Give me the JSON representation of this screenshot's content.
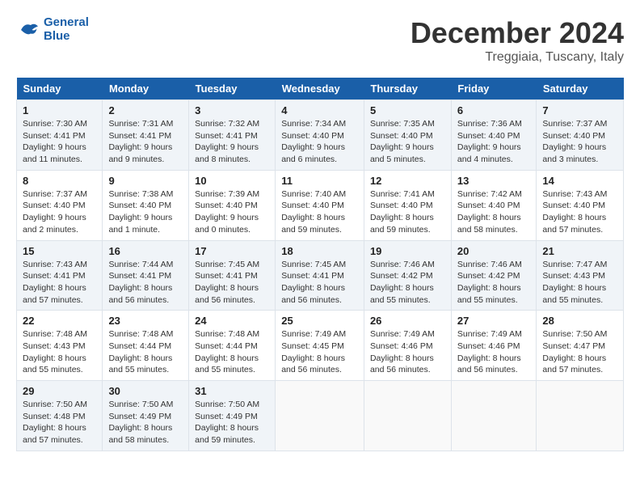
{
  "header": {
    "logo_line1": "General",
    "logo_line2": "Blue",
    "month": "December 2024",
    "location": "Treggiaia, Tuscany, Italy"
  },
  "days_of_week": [
    "Sunday",
    "Monday",
    "Tuesday",
    "Wednesday",
    "Thursday",
    "Friday",
    "Saturday"
  ],
  "weeks": [
    [
      {
        "day": 1,
        "rise": "7:30 AM",
        "set": "4:41 PM",
        "daylight": "9 hours and 11 minutes."
      },
      {
        "day": 2,
        "rise": "7:31 AM",
        "set": "4:41 PM",
        "daylight": "9 hours and 9 minutes."
      },
      {
        "day": 3,
        "rise": "7:32 AM",
        "set": "4:41 PM",
        "daylight": "9 hours and 8 minutes."
      },
      {
        "day": 4,
        "rise": "7:34 AM",
        "set": "4:40 PM",
        "daylight": "9 hours and 6 minutes."
      },
      {
        "day": 5,
        "rise": "7:35 AM",
        "set": "4:40 PM",
        "daylight": "9 hours and 5 minutes."
      },
      {
        "day": 6,
        "rise": "7:36 AM",
        "set": "4:40 PM",
        "daylight": "9 hours and 4 minutes."
      },
      {
        "day": 7,
        "rise": "7:37 AM",
        "set": "4:40 PM",
        "daylight": "9 hours and 3 minutes."
      }
    ],
    [
      {
        "day": 8,
        "rise": "7:37 AM",
        "set": "4:40 PM",
        "daylight": "9 hours and 2 minutes."
      },
      {
        "day": 9,
        "rise": "7:38 AM",
        "set": "4:40 PM",
        "daylight": "9 hours and 1 minute."
      },
      {
        "day": 10,
        "rise": "7:39 AM",
        "set": "4:40 PM",
        "daylight": "9 hours and 0 minutes."
      },
      {
        "day": 11,
        "rise": "7:40 AM",
        "set": "4:40 PM",
        "daylight": "8 hours and 59 minutes."
      },
      {
        "day": 12,
        "rise": "7:41 AM",
        "set": "4:40 PM",
        "daylight": "8 hours and 59 minutes."
      },
      {
        "day": 13,
        "rise": "7:42 AM",
        "set": "4:40 PM",
        "daylight": "8 hours and 58 minutes."
      },
      {
        "day": 14,
        "rise": "7:43 AM",
        "set": "4:40 PM",
        "daylight": "8 hours and 57 minutes."
      }
    ],
    [
      {
        "day": 15,
        "rise": "7:43 AM",
        "set": "4:41 PM",
        "daylight": "8 hours and 57 minutes."
      },
      {
        "day": 16,
        "rise": "7:44 AM",
        "set": "4:41 PM",
        "daylight": "8 hours and 56 minutes."
      },
      {
        "day": 17,
        "rise": "7:45 AM",
        "set": "4:41 PM",
        "daylight": "8 hours and 56 minutes."
      },
      {
        "day": 18,
        "rise": "7:45 AM",
        "set": "4:41 PM",
        "daylight": "8 hours and 56 minutes."
      },
      {
        "day": 19,
        "rise": "7:46 AM",
        "set": "4:42 PM",
        "daylight": "8 hours and 55 minutes."
      },
      {
        "day": 20,
        "rise": "7:46 AM",
        "set": "4:42 PM",
        "daylight": "8 hours and 55 minutes."
      },
      {
        "day": 21,
        "rise": "7:47 AM",
        "set": "4:43 PM",
        "daylight": "8 hours and 55 minutes."
      }
    ],
    [
      {
        "day": 22,
        "rise": "7:48 AM",
        "set": "4:43 PM",
        "daylight": "8 hours and 55 minutes."
      },
      {
        "day": 23,
        "rise": "7:48 AM",
        "set": "4:44 PM",
        "daylight": "8 hours and 55 minutes."
      },
      {
        "day": 24,
        "rise": "7:48 AM",
        "set": "4:44 PM",
        "daylight": "8 hours and 55 minutes."
      },
      {
        "day": 25,
        "rise": "7:49 AM",
        "set": "4:45 PM",
        "daylight": "8 hours and 56 minutes."
      },
      {
        "day": 26,
        "rise": "7:49 AM",
        "set": "4:46 PM",
        "daylight": "8 hours and 56 minutes."
      },
      {
        "day": 27,
        "rise": "7:49 AM",
        "set": "4:46 PM",
        "daylight": "8 hours and 56 minutes."
      },
      {
        "day": 28,
        "rise": "7:50 AM",
        "set": "4:47 PM",
        "daylight": "8 hours and 57 minutes."
      }
    ],
    [
      {
        "day": 29,
        "rise": "7:50 AM",
        "set": "4:48 PM",
        "daylight": "8 hours and 57 minutes."
      },
      {
        "day": 30,
        "rise": "7:50 AM",
        "set": "4:49 PM",
        "daylight": "8 hours and 58 minutes."
      },
      {
        "day": 31,
        "rise": "7:50 AM",
        "set": "4:49 PM",
        "daylight": "8 hours and 59 minutes."
      },
      null,
      null,
      null,
      null
    ]
  ]
}
